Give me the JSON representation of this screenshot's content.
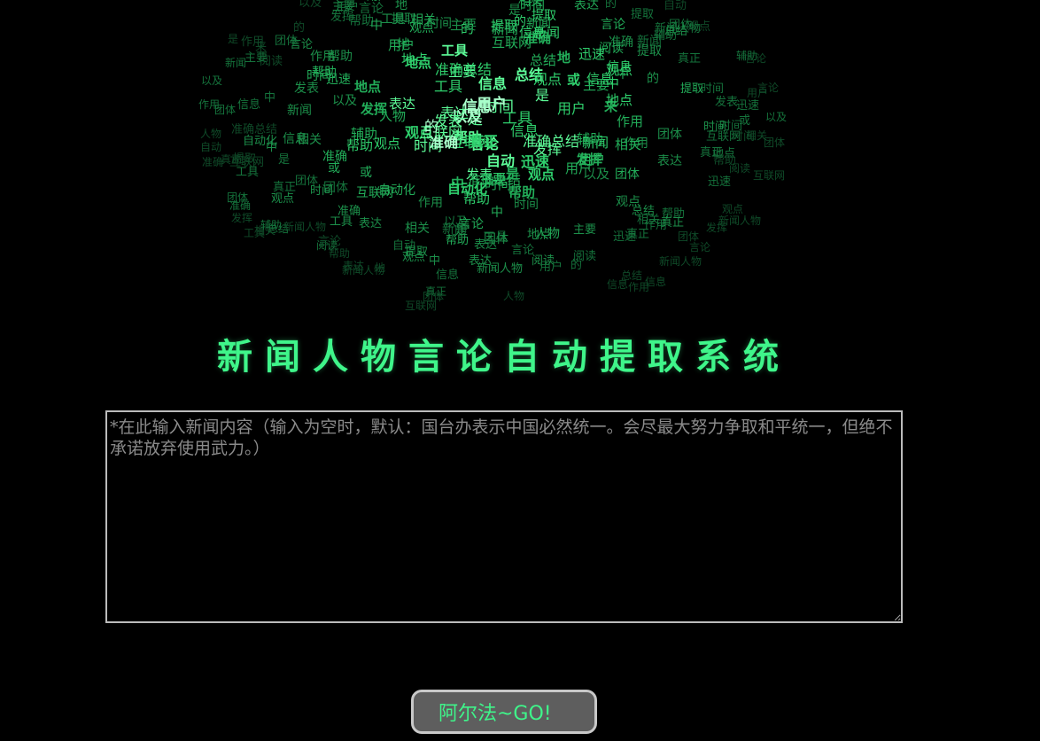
{
  "word_cloud": {
    "words": [
      "用户",
      "时间",
      "信息",
      "言论",
      "新闻人物",
      "地点",
      "自动",
      "提取",
      "帮助",
      "准确",
      "总结",
      "工具",
      "互联网",
      "团体",
      "观点",
      "主要",
      "相关",
      "表达",
      "发挥",
      "作用",
      "是",
      "或",
      "中",
      "的",
      "发表",
      "地",
      "来",
      "以及",
      "总结",
      "真正",
      "辅助",
      "迅速",
      "阅读",
      "用户",
      "新闻",
      "人物",
      "帮助",
      "信息",
      "时间",
      "言论",
      "主要",
      "自动化",
      "准确总结",
      "提取",
      "观点",
      "工具",
      "以及",
      "团体",
      "自动",
      "新闻人物",
      "互联网",
      "用户",
      "地点",
      "时间",
      "准确",
      "发挥",
      "作用",
      "是",
      "的",
      "中",
      "信息",
      "帮助",
      "新闻",
      "阅读",
      "迅速",
      "真正",
      "辅助",
      "相关",
      "表达",
      "言论",
      "团体",
      "观点"
    ],
    "colors": [
      "#0f4a28",
      "#15733c",
      "#1c8f4a",
      "#22ad59",
      "#2fd06d",
      "#5dfb98",
      "#a9ffcb"
    ]
  },
  "page": {
    "title": "新闻人物言论自动提取系统"
  },
  "input": {
    "value": "",
    "placeholder": "*在此输入新闻内容（输入为空时，默认：国台办表示中国必然统一。会尽最大努力争取和平统一，但绝不承诺放弃使用武力。）"
  },
  "actions": {
    "submit_label": "阿尔法~GO!"
  }
}
